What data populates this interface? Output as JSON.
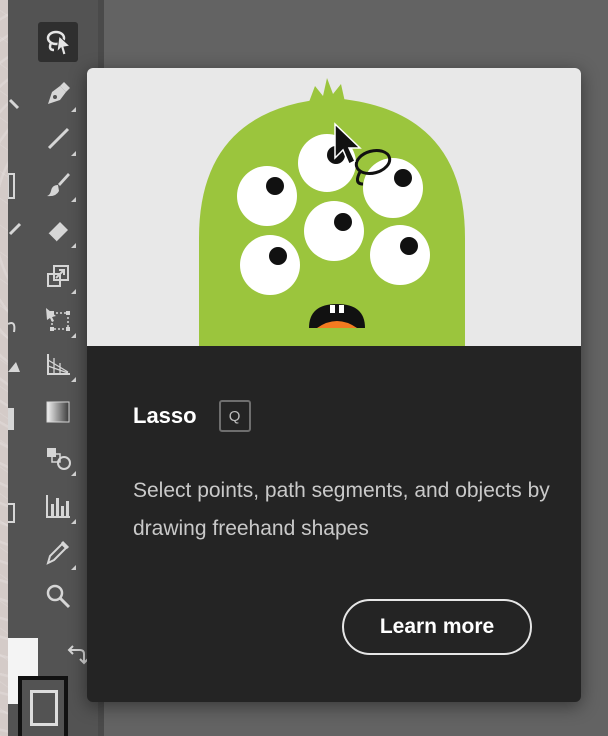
{
  "tooltip": {
    "title": "Lasso",
    "shortcut": "Q",
    "description": "Select points, path segments, and objects by drawing freehand shapes",
    "learn_more_label": "Learn more"
  },
  "toolbar": {
    "tools": [
      {
        "name": "lasso-tool",
        "icon": "lasso-icon",
        "active": true
      },
      {
        "name": "pen-tool",
        "icon": "pen-icon"
      },
      {
        "name": "line-tool",
        "icon": "line-icon"
      },
      {
        "name": "paintbrush-tool",
        "icon": "paintbrush-icon"
      },
      {
        "name": "eraser-tool",
        "icon": "eraser-icon"
      },
      {
        "name": "scale-tool",
        "icon": "scale-icon"
      },
      {
        "name": "free-transform-tool",
        "icon": "free-transform-icon"
      },
      {
        "name": "perspective-grid-tool",
        "icon": "perspective-grid-icon"
      },
      {
        "name": "gradient-tool",
        "icon": "gradient-icon"
      },
      {
        "name": "blend-tool",
        "icon": "blend-icon"
      },
      {
        "name": "graph-tool",
        "icon": "column-graph-icon"
      },
      {
        "name": "eyedropper-tool",
        "icon": "eyedropper-icon"
      },
      {
        "name": "zoom-tool",
        "icon": "zoom-icon"
      }
    ]
  },
  "colors": {
    "tooltip_bg": "#242424",
    "illustration_bg": "#e8e8e8",
    "monster_green": "#9bc53d",
    "mouth_orange": "#f47b20"
  }
}
